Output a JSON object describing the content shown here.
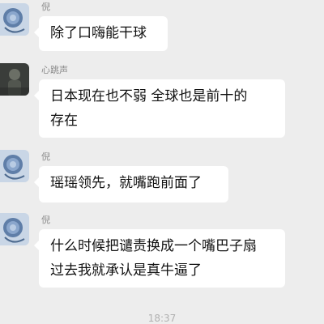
{
  "messages": [
    {
      "sender": "倪",
      "avatar": "rose-avatar",
      "text": "除了口嗨能干球"
    },
    {
      "sender": "心跳声",
      "avatar": "dark-photo-avatar",
      "text": "日本现在也不弱 全球也是前十的\n存在"
    },
    {
      "sender": "倪",
      "avatar": "rose-avatar",
      "text": "瑶瑶领先，就嘴跑前面了"
    },
    {
      "sender": "倪",
      "avatar": "rose-avatar",
      "text": "什么时候把谴责换成一个嘴巴子扇\n过去我就承认是真牛逼了"
    }
  ],
  "timestamp": "18:37"
}
